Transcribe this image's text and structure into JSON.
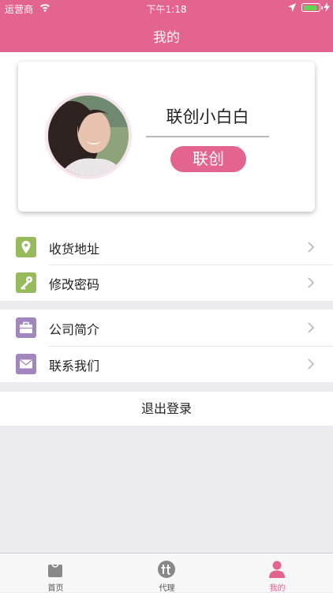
{
  "status_bar": {
    "carrier": "运营商",
    "time": "下午1:18",
    "battery_level": 0.9
  },
  "header": {
    "title": "我的"
  },
  "profile": {
    "name": "联创小白白",
    "badge": "联创"
  },
  "menu_group_1": [
    {
      "label": "收货地址",
      "icon": "location-icon"
    },
    {
      "label": "修改密码",
      "icon": "key-icon"
    }
  ],
  "menu_group_2": [
    {
      "label": "公司简介",
      "icon": "briefcase-icon"
    },
    {
      "label": "联系我们",
      "icon": "mail-icon"
    }
  ],
  "logout": {
    "label": "退出登录"
  },
  "tabbar": [
    {
      "label": "首页",
      "icon": "shopping-bag-icon",
      "active": false
    },
    {
      "label": "代理",
      "icon": "agent-icon",
      "active": false
    },
    {
      "label": "我的",
      "icon": "person-icon",
      "active": true
    }
  ],
  "colors": {
    "accent": "#e3648f",
    "green_icon": "#97bb5c",
    "purple_icon": "#a287bf",
    "background": "#ecebf0"
  }
}
